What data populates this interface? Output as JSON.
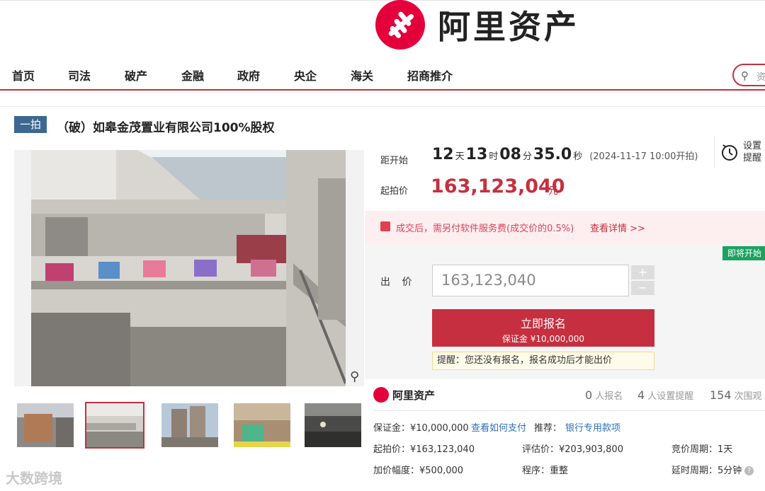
{
  "brand": {
    "name": "阿里资产"
  },
  "nav": {
    "items": [
      "首页",
      "司法",
      "破产",
      "金融",
      "政府",
      "央企",
      "海关",
      "招商推介"
    ],
    "search_placeholder": "资"
  },
  "listing": {
    "badge": "一拍",
    "title": "（破）如皋金茂置业有限公司100%股权"
  },
  "countdown": {
    "label": "距开始",
    "days": "12",
    "day_unit": "天",
    "hours": "13",
    "hour_unit": "时",
    "minutes": "08",
    "minute_unit": "分",
    "seconds": "35.0",
    "second_unit": "秒",
    "start_time": "(2024-11-17 10:00开拍)"
  },
  "remind": {
    "text": "设置提醒"
  },
  "price": {
    "label": "起拍价",
    "value": "163,123,040",
    "unit": "元"
  },
  "notice": {
    "text": "成交后，需另付软件服务费(成交价的0.5%)",
    "link": "查看详情 >>"
  },
  "bid": {
    "status_badge": "即将开始",
    "label": "出 价",
    "value": "163,123,040",
    "plus": "+",
    "minus": "−",
    "signup_label": "立即报名",
    "deposit_label": "保证金 ¥10,000,000",
    "tip": "提醒：您还没有报名，报名成功后才能出价"
  },
  "info": {
    "brand": "阿里资产",
    "signups_count": "0",
    "signups_label": "人报名",
    "reminders_count": "4",
    "reminders_label": "人设置提醒",
    "views_count": "154",
    "views_label": "次围观",
    "deposit": "保证金：¥10,000,000",
    "how_to_pay": "查看如何支付",
    "recommend_label": "推荐：",
    "recommend_link": "银行专用款项",
    "start_price": "起拍价：¥163,123,040",
    "assessed_price": "评估价：¥203,903,800",
    "bid_cycle": "竞价周期：1天",
    "increment": "加价幅度：¥500,000",
    "procedure": "程序：重整",
    "delay_cycle": "延时周期：5分钟"
  },
  "watermark": "大数跨境",
  "colors": {
    "accent": "#c62f3f",
    "brand_red": "#e4003a",
    "badge_blue": "#3c6793",
    "status_green": "#1aa260",
    "link_blue": "#2e6fba"
  },
  "icons": [
    "search-icon",
    "zoom-icon",
    "clock-icon",
    "gift-icon",
    "help-icon"
  ]
}
